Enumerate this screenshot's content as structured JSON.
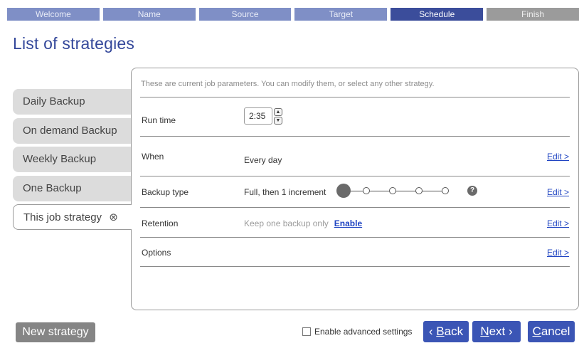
{
  "wizard": {
    "steps": [
      "Welcome",
      "Name",
      "Source",
      "Target",
      "Schedule",
      "Finish"
    ],
    "active_step": "Schedule"
  },
  "page_title": "List of strategies",
  "strategies": [
    {
      "label": "Daily Backup"
    },
    {
      "label": "On demand Backup"
    },
    {
      "label": "Weekly Backup"
    },
    {
      "label": "One Backup"
    },
    {
      "label": "This job strategy",
      "close_glyph": "⊗"
    }
  ],
  "panel": {
    "hint": "These are current job parameters. You can modify them, or select any other strategy.",
    "run_time": {
      "label": "Run time",
      "value": "2:35"
    },
    "when": {
      "label": "When",
      "value": "Every day",
      "edit": "Edit >"
    },
    "backup_type": {
      "label": "Backup type",
      "value": "Full, then 1 increment",
      "edit": "Edit >",
      "help": "?",
      "slider_position": 0,
      "slider_stops": 5
    },
    "retention": {
      "label": "Retention",
      "value": "Keep one backup only",
      "link": "Enable",
      "edit": "Edit >"
    },
    "options": {
      "label": "Options",
      "edit": "Edit >"
    }
  },
  "footer": {
    "new_strategy": "New strategy",
    "advanced_settings": "Enable advanced settings",
    "advanced_checked": false,
    "back": {
      "arrow": "‹",
      "key": "B",
      "rest": "ack"
    },
    "next": {
      "key": "N",
      "rest": "ext",
      "arrow": "›"
    },
    "cancel": {
      "key": "C",
      "rest": "ancel"
    }
  },
  "colors": {
    "accent": "#3b55b5",
    "active_step": "#3b4d9b",
    "inactive_step": "#7f8fc6",
    "title": "#33479a",
    "link": "#1f44c2"
  }
}
